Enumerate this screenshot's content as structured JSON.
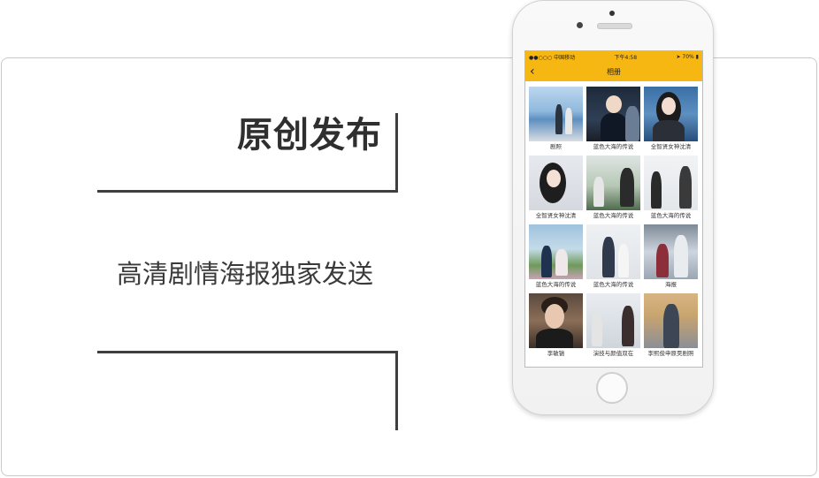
{
  "left": {
    "headline": "原创发布",
    "subhead": "高清剧情海报独家发送"
  },
  "phone": {
    "status": {
      "carrier": "●●○○○ 中国移动",
      "time": "下午4:58",
      "battery": "70%"
    },
    "nav": {
      "back_glyph": "‹",
      "title": "相册"
    },
    "album": [
      {
        "caption": "剧照"
      },
      {
        "caption": "蓝色大海的传说"
      },
      {
        "caption": "全智贤女神沈清"
      },
      {
        "caption": "全智贤女神沈清"
      },
      {
        "caption": "蓝色大海的传说"
      },
      {
        "caption": "蓝色大海的传说"
      },
      {
        "caption": "蓝色大海的传说"
      },
      {
        "caption": "蓝色大海的传说"
      },
      {
        "caption": "海报"
      },
      {
        "caption": "李敏镐"
      },
      {
        "caption": "演技与颜值双在"
      },
      {
        "caption": "李熙俊申原昊剧照"
      }
    ]
  },
  "colors": {
    "accent": "#f7b713",
    "text_dark": "#2f2f2f",
    "frame_line": "#3f3f3f"
  }
}
